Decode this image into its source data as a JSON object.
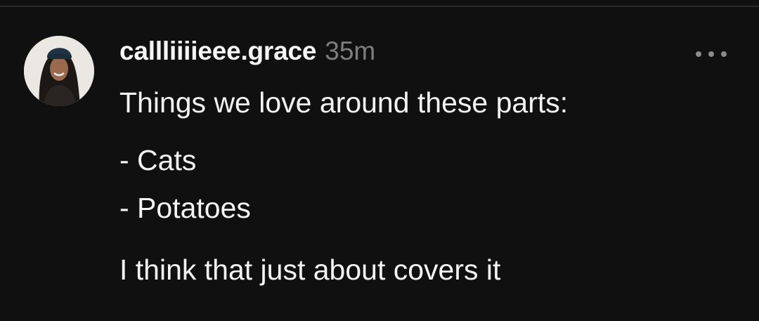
{
  "post": {
    "username": "callliiiieee.grace",
    "timestamp": "35m",
    "intro": "Things we love around these parts:",
    "list": [
      "- Cats",
      "- Potatoes"
    ],
    "outro": "I think that just about covers it"
  },
  "icons": {
    "more": "more-horizontal-icon",
    "avatar": "profile-photo"
  },
  "colors": {
    "background": "#101010",
    "text": "#f3f3f3",
    "timestamp": "#7d7d7d",
    "icon": "#8a8a8a"
  }
}
